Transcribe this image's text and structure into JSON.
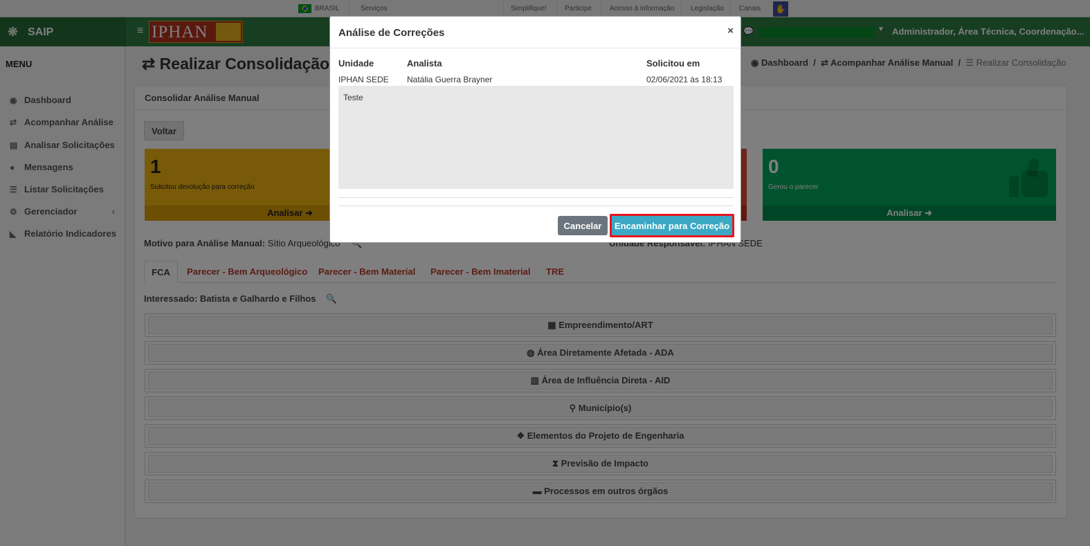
{
  "govbar": {
    "brasil": "BRASIL",
    "servicos": "Serviços",
    "links": [
      "Simplifique!",
      "Participe",
      "Acesso à informação",
      "Legislação",
      "Canais"
    ]
  },
  "header": {
    "app_name": "SAIP",
    "logo_text": "IPHAN",
    "user": "Administrador, Área Técnica, Coordenação..."
  },
  "sidebar": {
    "title": "MENU",
    "items": [
      {
        "label": "Dashboard",
        "icon": "dashboard-icon"
      },
      {
        "label": "Acompanhar Análise",
        "icon": "exchange-icon"
      },
      {
        "label": "Analisar Solicitações",
        "icon": "book-icon"
      },
      {
        "label": "Mensagens",
        "icon": "comments-icon"
      },
      {
        "label": "Listar Solicitações",
        "icon": "list-icon"
      },
      {
        "label": "Gerenciador",
        "icon": "cogs-icon"
      },
      {
        "label": "Relatório Indicadores",
        "icon": "area-chart-icon"
      }
    ]
  },
  "main": {
    "title": "Realizar Consolidação d",
    "breadcrumb": [
      "Dashboard",
      "Acompanhar Análise Manual",
      "Realizar Consolidação"
    ],
    "card_title": "Consolidar Análise Manual",
    "back_button": "Voltar",
    "boxes": [
      {
        "number": "1",
        "text": "Solicitou devolução para correção",
        "action": "Analisar"
      },
      {
        "number": "0",
        "text": "Gerou o parecer",
        "action": "Analisar"
      }
    ],
    "motivo_label": "Motivo para Análise Manual:",
    "motivo_value": "Sítio Arqueológico",
    "unidade_label": "Unidade Responsável:",
    "unidade_value": "IPHAN SEDE",
    "tabs": [
      "FCA",
      "Parecer - Bem Arqueológico",
      "Parecer - Bem Material",
      "Parecer - Bem Imaterial",
      "TRE"
    ],
    "interessado": "Interessado: Batista e Galhardo e Filhos",
    "sections": [
      "Empreendimento/ART",
      "Área Diretamente Afetada - ADA",
      "Área de Influência Direta - AID",
      "Município(s)",
      "Elementos do Projeto de Engenharia",
      "Previsão de Impacto",
      "Processos em outros órgãos"
    ]
  },
  "modal": {
    "title": "Análise de Correções",
    "close": "×",
    "columns": [
      "Unidade",
      "Analista",
      "Solicitou em"
    ],
    "row": [
      "IPHAN SEDE",
      "Natália Guerra Brayner",
      "02/06/2021 às 18:13"
    ],
    "note": "Teste",
    "cancel": "Cancelar",
    "forward": "Encaminhar para Correção"
  },
  "colors": {
    "header_green": "#2e7d43",
    "yellow_box": "#f0b410",
    "green_box": "#00a65a",
    "forward_button": "#3ba8c4",
    "highlight": "#e8141c"
  }
}
